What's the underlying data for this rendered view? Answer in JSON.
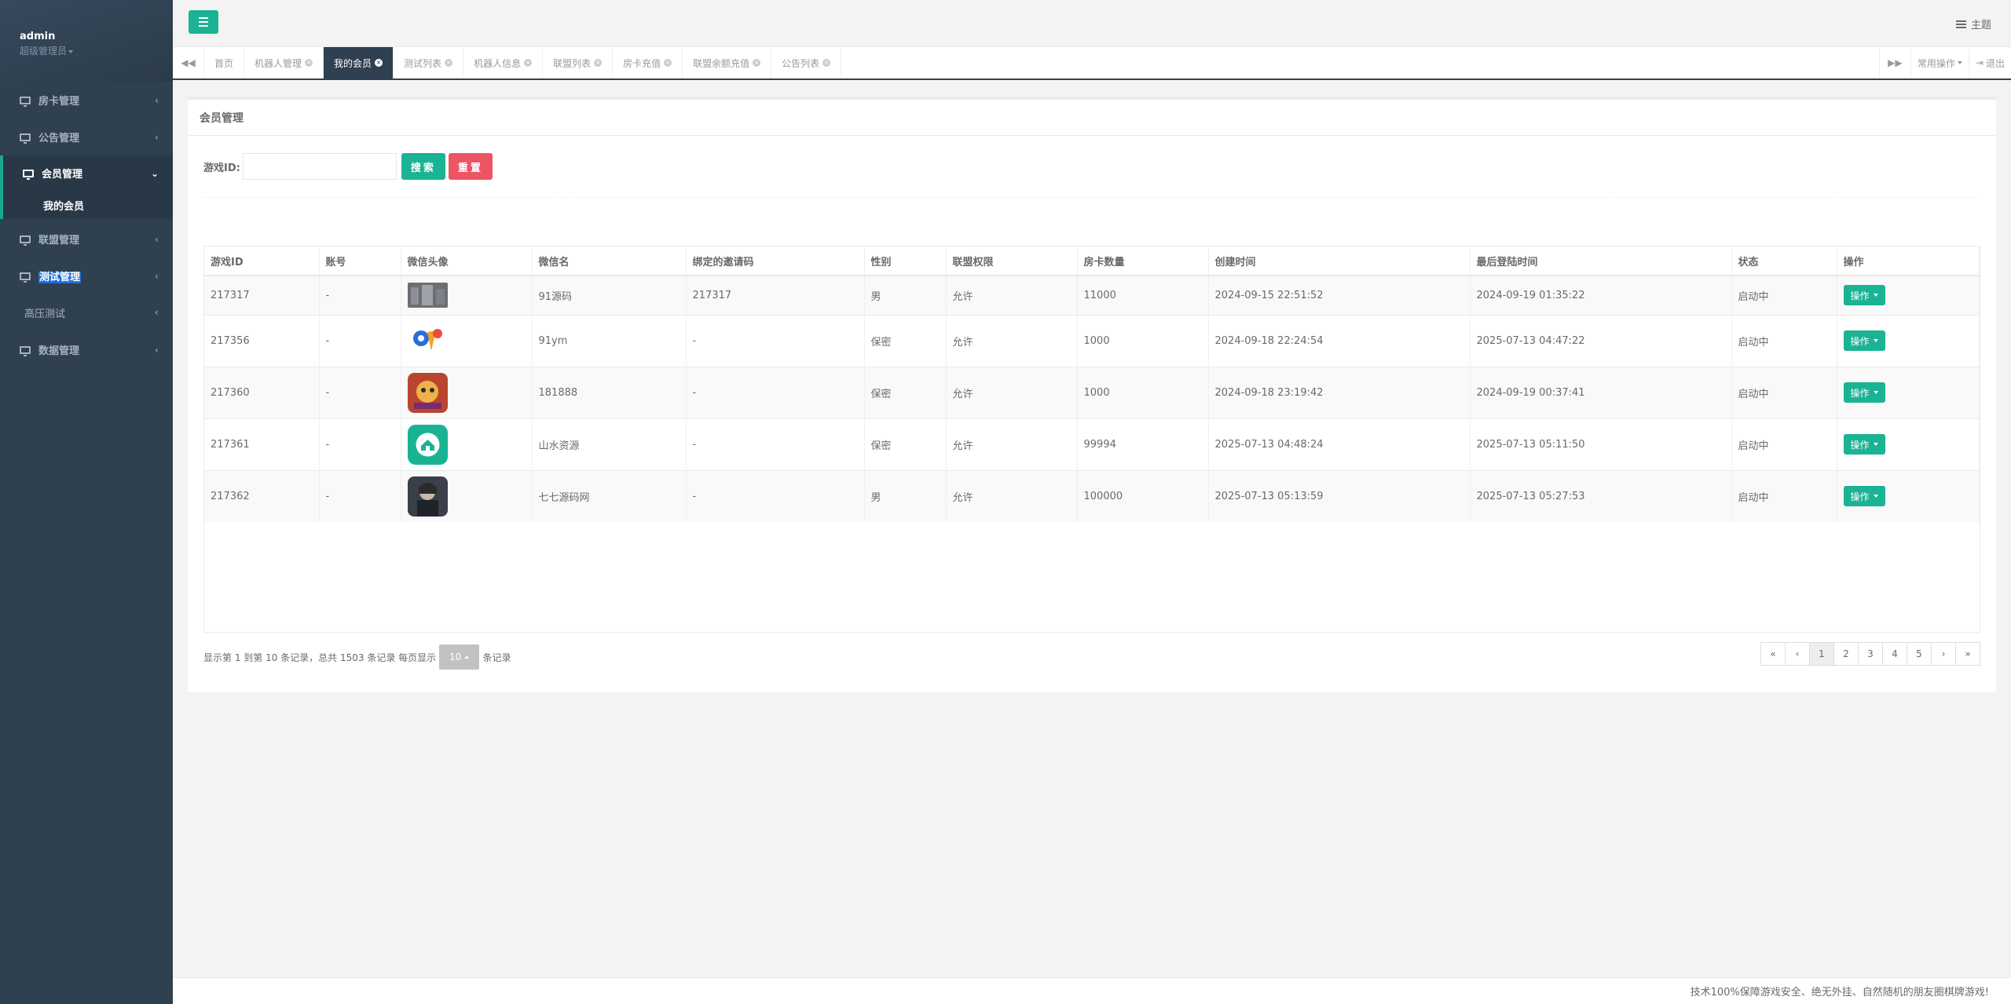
{
  "profile": {
    "name": "admin",
    "role": "超级管理员"
  },
  "sidebar": {
    "items": [
      {
        "label": "房卡管理"
      },
      {
        "label": "公告管理"
      },
      {
        "label": "会员管理",
        "sub": "我的会员"
      },
      {
        "label": "联盟管理"
      },
      {
        "label": "测试管理"
      },
      {
        "label": "高压测试"
      },
      {
        "label": "数据管理"
      }
    ]
  },
  "topbar": {
    "theme": "主题"
  },
  "tabs": [
    "首页",
    "机器人管理",
    "我的会员",
    "测试列表",
    "机器人信息",
    "联盟列表",
    "房卡充值",
    "联盟余额充值",
    "公告列表"
  ],
  "tabbar_right": {
    "ops": "常用操作",
    "logout": "退出"
  },
  "panel": {
    "title": "会员管理"
  },
  "search": {
    "label": "游戏ID:",
    "value": "",
    "search_btn": "搜索",
    "reset_btn": "重置"
  },
  "table": {
    "headers": [
      "游戏ID",
      "账号",
      "微信头像",
      "微信名",
      "绑定的邀请码",
      "性别",
      "联盟权限",
      "房卡数量",
      "创建时间",
      "最后登陆时间",
      "状态",
      "操作"
    ],
    "rows": [
      [
        "217317",
        "-",
        "",
        "91源码",
        "217317",
        "男",
        "允许",
        "11000",
        "2024-09-15 22:51:52",
        "2024-09-19 01:35:22",
        "启动中",
        "操作"
      ],
      [
        "217356",
        "-",
        "",
        "91ym",
        "-",
        "保密",
        "允许",
        "1000",
        "2024-09-18 22:24:54",
        "2025-07-13 04:47:22",
        "启动中",
        "操作"
      ],
      [
        "217360",
        "-",
        "",
        "181888",
        "-",
        "保密",
        "允许",
        "1000",
        "2024-09-18 23:19:42",
        "2024-09-19 00:37:41",
        "启动中",
        "操作"
      ],
      [
        "217361",
        "-",
        "",
        "山水资源",
        "-",
        "保密",
        "允许",
        "99994",
        "2025-07-13 04:48:24",
        "2025-07-13 05:11:50",
        "启动中",
        "操作"
      ],
      [
        "217362",
        "-",
        "",
        "七七源码网",
        "-",
        "男",
        "允许",
        "100000",
        "2025-07-13 05:13:59",
        "2025-07-13 05:27:53",
        "启动中",
        "操作"
      ]
    ]
  },
  "pagination": {
    "info_prefix": "显示第 1 到第 10 条记录，总共 1503 条记录 每页显示",
    "page_size": "10",
    "info_suffix": "条记录",
    "pages": [
      "«",
      "‹",
      "1",
      "2",
      "3",
      "4",
      "5",
      "›",
      "»"
    ]
  },
  "footer": {
    "text": "技术100%保障游戏安全、绝无外挂、自然随机的朋友圈棋牌游戏!"
  }
}
